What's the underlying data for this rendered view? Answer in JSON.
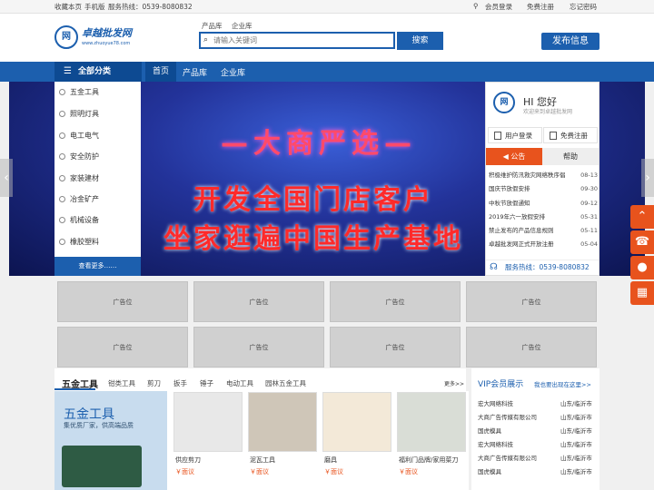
{
  "topbar": {
    "links": [
      "收藏本页",
      "手机版",
      "服务热线：0539-8080832"
    ],
    "member_center": "会员登录",
    "register": "免费注册",
    "forgot": "忘记密码"
  },
  "header": {
    "logo_cn": "卓越批发网",
    "logo_url": "www.zhuoyue78.com",
    "search_tabs": [
      "产品库",
      "企业库"
    ],
    "search_placeholder": "请输入关键词",
    "search_button": "搜索",
    "publish_button": "发布信息"
  },
  "nav": {
    "category_label": "全部分类",
    "items": [
      "首页",
      "产品库",
      "企业库"
    ]
  },
  "categories": [
    "五金工具",
    "照明灯具",
    "电工电气",
    "安全防护",
    "家装建材",
    "冶金矿产",
    "机械设备",
    "橡胶塑料"
  ],
  "category_more": "查看更多……",
  "banner": {
    "line1": "—大商严选—",
    "line2": "开发全国门店客户",
    "line3": "坐家逛遍中国生产基地"
  },
  "sidebox": {
    "greeting": "HI 您好",
    "welcome": "欢迎来到卓越批发网",
    "login": "用户登录",
    "register": "免费注册",
    "tab_notice": "公告",
    "tab_help": "帮助",
    "notices": [
      {
        "title": "积极维护防汛救灾网络秩序倡",
        "date": "08-13"
      },
      {
        "title": "国庆节放假安排",
        "date": "09-30"
      },
      {
        "title": "中秋节放假通知",
        "date": "09-12"
      },
      {
        "title": "2019年六一放假安排",
        "date": "05-31"
      },
      {
        "title": "禁止发布的产品信息规则",
        "date": "05-11"
      },
      {
        "title": "卓越批发网正式开放注册",
        "date": "05-04"
      }
    ],
    "hotline": "服务热线：0539-8080832"
  },
  "ads": [
    "广告位",
    "广告位",
    "广告位",
    "广告位",
    "广告位",
    "广告位",
    "广告位",
    "广告位"
  ],
  "section": {
    "title": "五金工具",
    "subs": [
      "钳类工具",
      "剪刀",
      "扳手",
      "锤子",
      "电动工具",
      "园林五金工具"
    ],
    "more": "更多>>",
    "promo_title": "五金工具",
    "promo_sub": "集优质厂家，供高端品质",
    "products": [
      {
        "name": "供应剪刀",
        "price": "￥面议"
      },
      {
        "name": "泥瓦工具",
        "price": "￥面议"
      },
      {
        "name": "磨具",
        "price": "￥面议"
      },
      {
        "name": "福利门品牌/家用菜刀",
        "price": "￥面议"
      }
    ]
  },
  "vip": {
    "title": "VIP会员展示",
    "subtitle": "我也要出现在这里>>",
    "members": [
      {
        "name": "宏大网络科技",
        "city": "山东/临沂市"
      },
      {
        "name": "大商广告传媒有限公司",
        "city": "山东/临沂市"
      },
      {
        "name": "国虎模具",
        "city": "山东/临沂市"
      },
      {
        "name": "宏大网络科技",
        "city": "山东/临沂市"
      },
      {
        "name": "大商广告传媒有限公司",
        "city": "山东/临沂市"
      },
      {
        "name": "国虎模具",
        "city": "山东/临沂市"
      }
    ]
  },
  "colors": {
    "brand": "#1c5fae",
    "accent": "#e8531d"
  }
}
